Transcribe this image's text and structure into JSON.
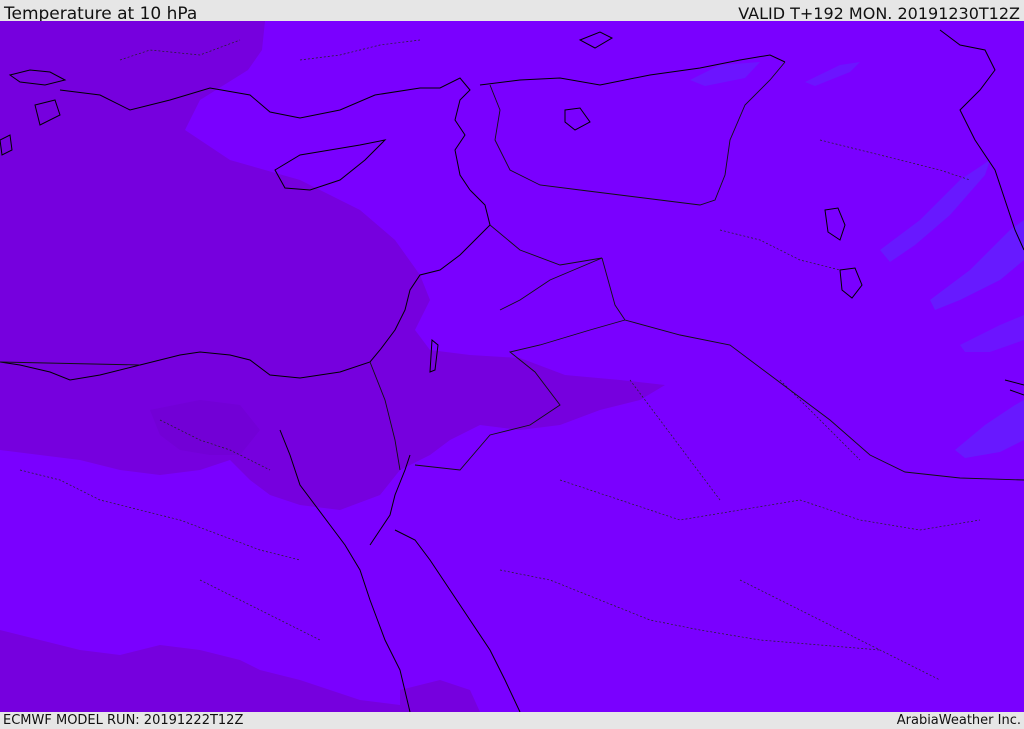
{
  "header": {
    "title": "Temperature at 10 hPa",
    "valid": "VALID T+192 MON. 20191230T12Z"
  },
  "footer": {
    "model_run": "ECMWF MODEL RUN: 20191222T12Z",
    "brand": "ArabiaWeather Inc."
  },
  "colors": {
    "background_field": "#7a00ff",
    "warm_field": "#7700dd",
    "cool_field": "#5a2cff",
    "coastline": "#000000",
    "border": "#222222"
  }
}
